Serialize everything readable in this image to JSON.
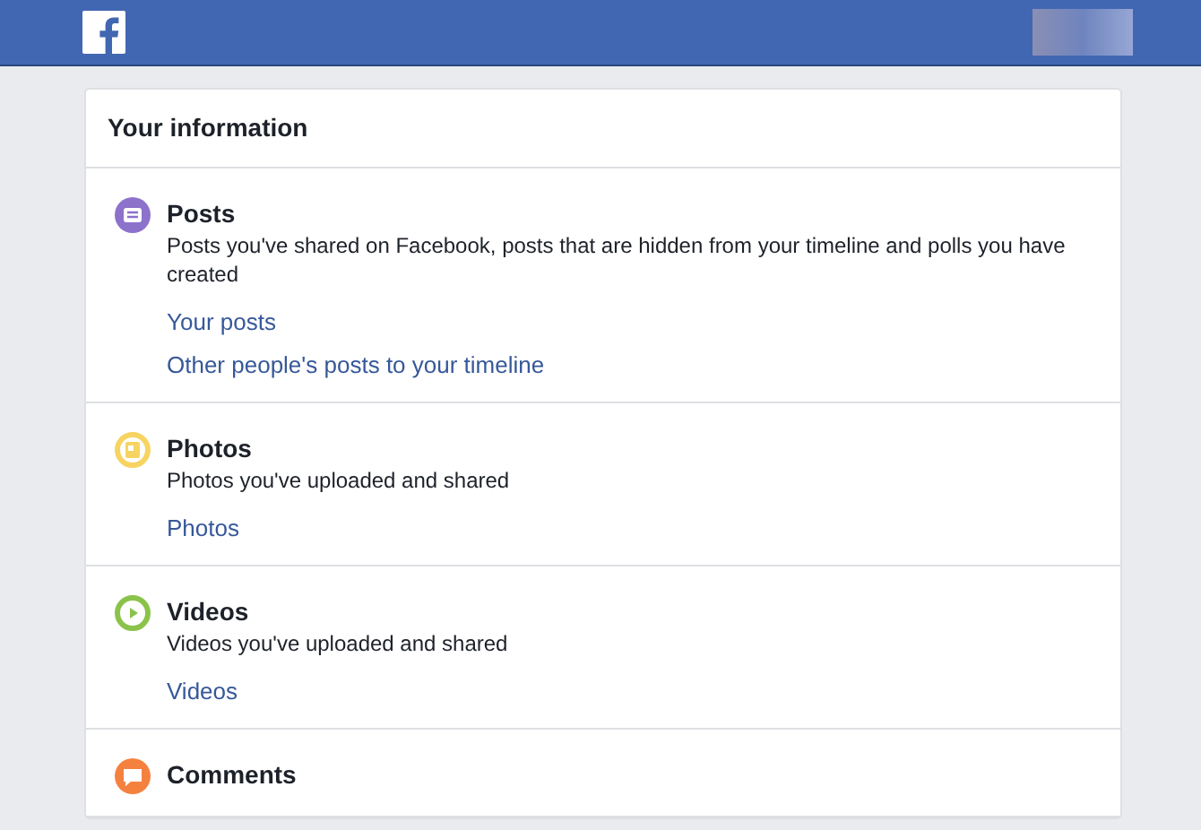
{
  "card": {
    "title": "Your information"
  },
  "sections": [
    {
      "kind": "posts",
      "color": "#8c72cb",
      "title": "Posts",
      "description": "Posts you've shared on Facebook, posts that are hidden from your timeline and polls you have created",
      "links": [
        "Your posts",
        "Other people's posts to your timeline"
      ]
    },
    {
      "kind": "photos",
      "color": "#f7d462",
      "title": "Photos",
      "description": "Photos you've uploaded and shared",
      "links": [
        "Photos"
      ]
    },
    {
      "kind": "videos",
      "color": "#8bc34a",
      "title": "Videos",
      "description": "Videos you've uploaded and shared",
      "links": [
        "Videos"
      ]
    },
    {
      "kind": "comments",
      "color": "#f5813f",
      "title": "Comments"
    }
  ]
}
